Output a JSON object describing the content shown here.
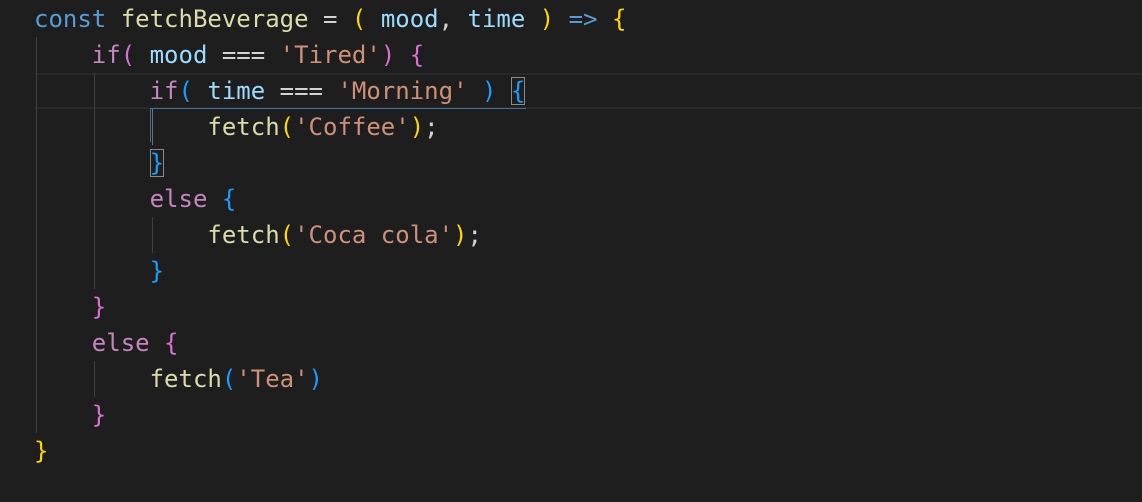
{
  "colors": {
    "background": "#1e1e1f",
    "keyword": "#569cd6",
    "control": "#c586c0",
    "function": "#dcdcaa",
    "variable": "#9cdcfe",
    "string": "#ce9178",
    "bracket_level_1": "#ffd700",
    "bracket_level_2": "#da70d6",
    "bracket_level_3": "#179fff"
  },
  "code": {
    "lines": [
      {
        "tokens": [
          {
            "t": "const",
            "k": "kw"
          },
          {
            "t": " "
          },
          {
            "t": "fetchBeverage",
            "k": "fn"
          },
          {
            "t": " ",
            "k": "op"
          },
          {
            "t": "=",
            "k": "op"
          },
          {
            "t": " "
          },
          {
            "t": "(",
            "k": "b1"
          },
          {
            "t": " "
          },
          {
            "t": "mood",
            "k": "var"
          },
          {
            "t": ", ",
            "k": "punc"
          },
          {
            "t": "time",
            "k": "var"
          },
          {
            "t": " "
          },
          {
            "t": ")",
            "k": "b1"
          },
          {
            "t": " "
          },
          {
            "t": "=>",
            "k": "kw"
          },
          {
            "t": " "
          },
          {
            "t": "{",
            "k": "b1"
          }
        ]
      },
      {
        "tokens": [
          {
            "t": "    "
          },
          {
            "t": "if",
            "k": "ctrl"
          },
          {
            "t": "(",
            "k": "b2"
          },
          {
            "t": " "
          },
          {
            "t": "mood",
            "k": "var"
          },
          {
            "t": " "
          },
          {
            "t": "===",
            "k": "op"
          },
          {
            "t": " "
          },
          {
            "t": "'Tired'",
            "k": "str"
          },
          {
            "t": ")",
            "k": "b2"
          },
          {
            "t": " "
          },
          {
            "t": "{",
            "k": "b2"
          }
        ]
      },
      {
        "tokens": [
          {
            "t": "        "
          },
          {
            "t": "if",
            "k": "ctrl"
          },
          {
            "t": "(",
            "k": "b3"
          },
          {
            "t": " "
          },
          {
            "t": "time",
            "k": "var"
          },
          {
            "t": " "
          },
          {
            "t": "===",
            "k": "op"
          },
          {
            "t": " "
          },
          {
            "t": "'Morning'",
            "k": "str"
          },
          {
            "t": " "
          },
          {
            "t": ")",
            "k": "b3"
          },
          {
            "t": " "
          },
          {
            "t": "{",
            "k": "b3 bm"
          }
        ]
      },
      {
        "tokens": [
          {
            "t": "            "
          },
          {
            "t": "fetch",
            "k": "fn"
          },
          {
            "t": "(",
            "k": "b1"
          },
          {
            "t": "'Coffee'",
            "k": "str"
          },
          {
            "t": ")",
            "k": "b1"
          },
          {
            "t": ";",
            "k": "punc"
          }
        ]
      },
      {
        "tokens": [
          {
            "t": "        "
          },
          {
            "t": "}",
            "k": "b3 bm"
          }
        ]
      },
      {
        "tokens": [
          {
            "t": "        "
          },
          {
            "t": "else",
            "k": "ctrl"
          },
          {
            "t": " "
          },
          {
            "t": "{",
            "k": "b3"
          }
        ]
      },
      {
        "tokens": [
          {
            "t": "            "
          },
          {
            "t": "fetch",
            "k": "fn"
          },
          {
            "t": "(",
            "k": "b1"
          },
          {
            "t": "'Coca cola'",
            "k": "str"
          },
          {
            "t": ")",
            "k": "b1"
          },
          {
            "t": ";",
            "k": "punc"
          }
        ]
      },
      {
        "tokens": [
          {
            "t": "        "
          },
          {
            "t": "}",
            "k": "b3"
          }
        ]
      },
      {
        "tokens": [
          {
            "t": "    "
          },
          {
            "t": "}",
            "k": "b2"
          }
        ]
      },
      {
        "tokens": [
          {
            "t": "    "
          },
          {
            "t": "else",
            "k": "ctrl"
          },
          {
            "t": " "
          },
          {
            "t": "{",
            "k": "b2"
          }
        ]
      },
      {
        "tokens": [
          {
            "t": "        "
          },
          {
            "t": "fetch",
            "k": "fn"
          },
          {
            "t": "(",
            "k": "b3"
          },
          {
            "t": "'Tea'",
            "k": "str"
          },
          {
            "t": ")",
            "k": "b3"
          }
        ]
      },
      {
        "tokens": [
          {
            "t": "    "
          },
          {
            "t": "}",
            "k": "b2"
          }
        ]
      },
      {
        "tokens": [
          {
            "t": "}",
            "k": "b1"
          }
        ]
      }
    ]
  }
}
